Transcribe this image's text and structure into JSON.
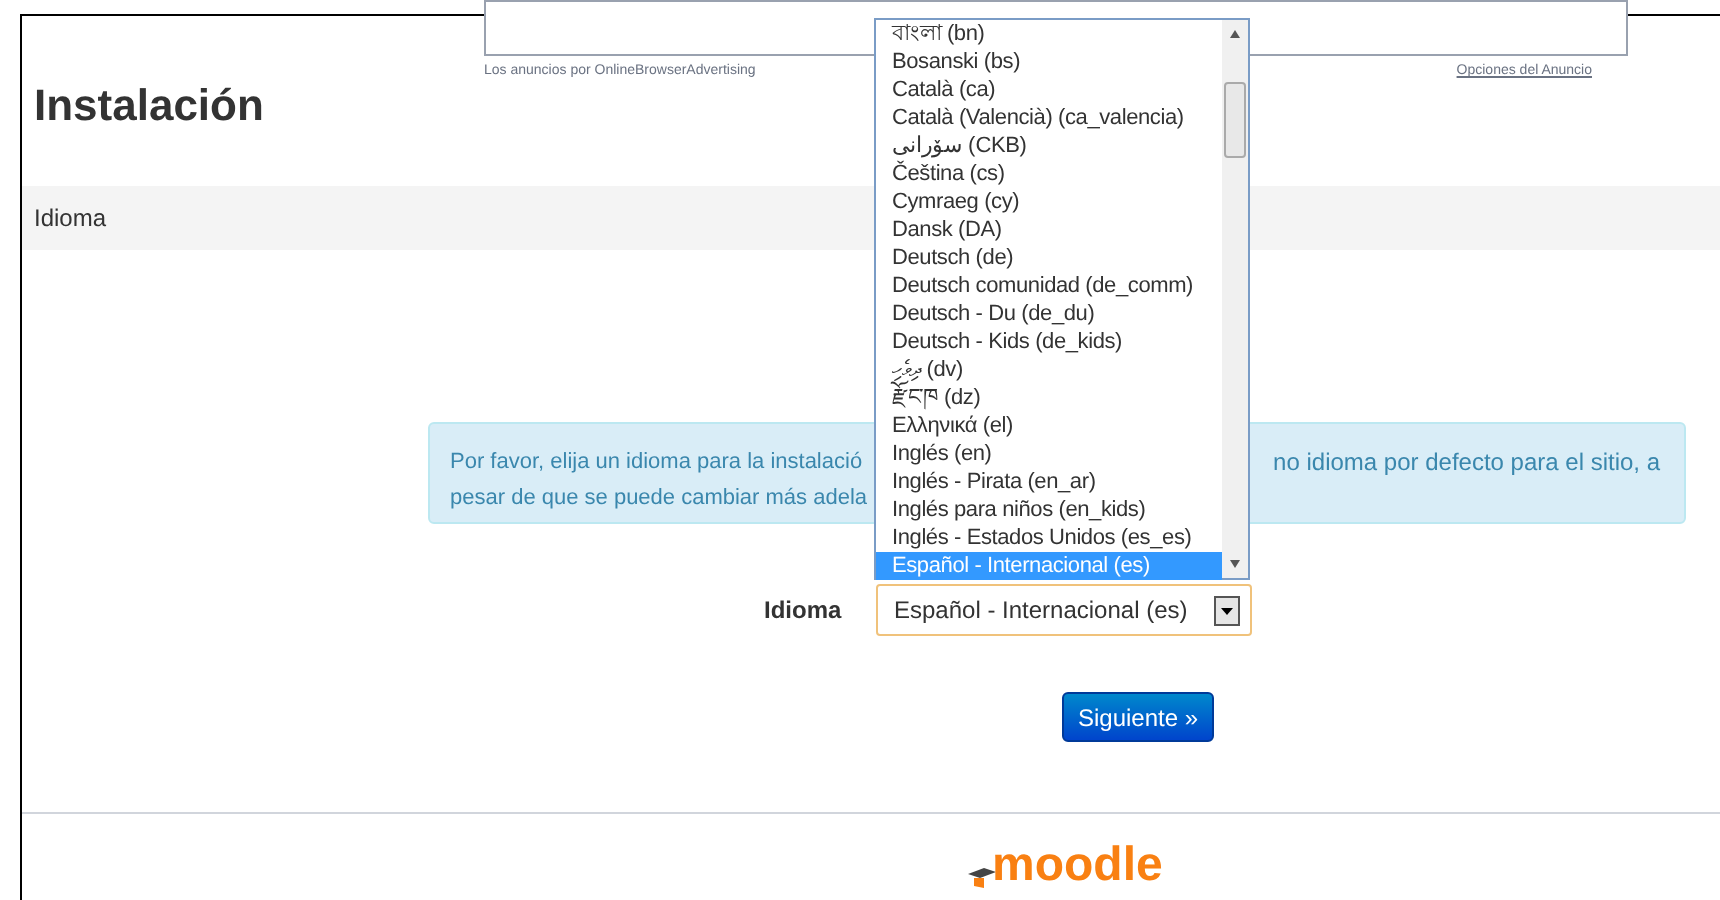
{
  "ad": {
    "caption": "Los anuncios por OnlineBrowserAdvertising",
    "options_link": "Opciones del Anuncio"
  },
  "page": {
    "title": "Instalación"
  },
  "section": {
    "title": "Idioma"
  },
  "notice": {
    "left_lines": [
      "Por favor, elija un idioma para la instalació",
      "pesar de que se puede cambiar más adela"
    ],
    "right_fragment": "no idioma por defecto para el sitio, a"
  },
  "language_field": {
    "label": "Idioma",
    "value": "Español - Internacional (es)",
    "expanded": true,
    "options": [
      {
        "label": "বাংলা (bn)",
        "selected": false
      },
      {
        "label": "Bosanski (bs)",
        "selected": false
      },
      {
        "label": "Català (ca)",
        "selected": false
      },
      {
        "label": "Català (Valencià) (ca_valencia)",
        "selected": false
      },
      {
        "label": "سۆرانی (CKB)",
        "selected": false
      },
      {
        "label": "Čeština (cs)",
        "selected": false
      },
      {
        "label": "Cymraeg (cy)",
        "selected": false
      },
      {
        "label": "Dansk (DA)",
        "selected": false
      },
      {
        "label": "Deutsch (de)",
        "selected": false
      },
      {
        "label": "Deutsch comunidad (de_comm)",
        "selected": false
      },
      {
        "label": "Deutsch - Du (de_du)",
        "selected": false
      },
      {
        "label": "Deutsch - Kids (de_kids)",
        "selected": false
      },
      {
        "label": "ދިވެހި (dv)",
        "selected": false
      },
      {
        "label": "རྫོང་ཁ (dz)",
        "selected": false
      },
      {
        "label": "Ελληνικά (el)",
        "selected": false
      },
      {
        "label": "Inglés (en)",
        "selected": false
      },
      {
        "label": "Inglés - Pirata (en_ar)",
        "selected": false
      },
      {
        "label": "Inglés para niños (en_kids)",
        "selected": false
      },
      {
        "label": "Inglés - Estados Unidos (es_es)",
        "selected": false
      },
      {
        "label": "Español - Internacional (es)",
        "selected": true
      }
    ]
  },
  "next_button": "Siguiente »",
  "footer": {
    "logo": "moodle"
  }
}
